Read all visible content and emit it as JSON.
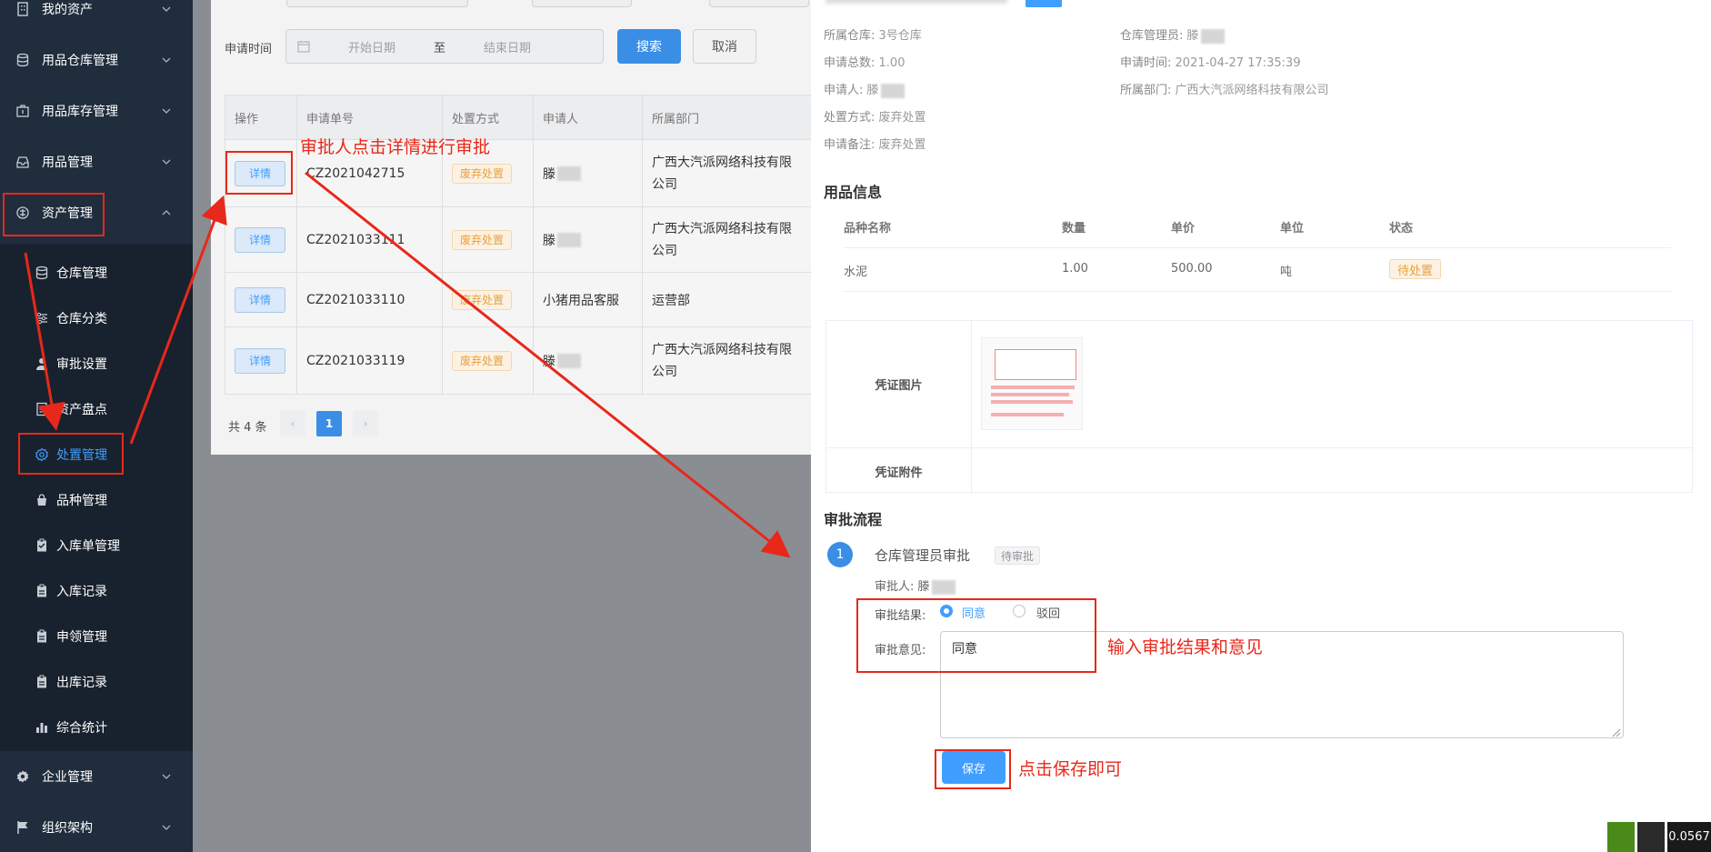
{
  "sidebar": {
    "top_items": [
      {
        "label": "我的资产",
        "icon": "building-icon"
      },
      {
        "label": "用品仓库管理",
        "icon": "database-icon"
      },
      {
        "label": "用品库存管理",
        "icon": "briefcase-icon"
      },
      {
        "label": "用品管理",
        "icon": "inbox-icon"
      },
      {
        "label": "资产管理",
        "icon": "asset-icon"
      }
    ],
    "sub_items": [
      {
        "label": "仓库管理",
        "icon": "database-icon"
      },
      {
        "label": "仓库分类",
        "icon": "sliders-icon"
      },
      {
        "label": "审批设置",
        "icon": "user-icon"
      },
      {
        "label": "资产盘点",
        "icon": "document-icon"
      },
      {
        "label": "处置管理",
        "icon": "gear-icon"
      },
      {
        "label": "品种管理",
        "icon": "bag-icon"
      },
      {
        "label": "入库单管理",
        "icon": "clipboard-icon"
      },
      {
        "label": "入库记录",
        "icon": "clipboard-icon"
      },
      {
        "label": "申领管理",
        "icon": "clipboard-icon"
      },
      {
        "label": "出库记录",
        "icon": "clipboard-icon"
      },
      {
        "label": "综合统计",
        "icon": "bar-chart-icon"
      }
    ],
    "bottom_items": [
      {
        "label": "企业管理",
        "icon": "gear-icon"
      },
      {
        "label": "组织架构",
        "icon": "flag-icon"
      }
    ]
  },
  "search": {
    "date_label": "申请时间",
    "start_placeholder": "开始日期",
    "separator": "至",
    "end_placeholder": "结束日期",
    "search_button": "搜索",
    "cancel_button": "取消"
  },
  "table": {
    "headers": [
      "操作",
      "申请单号",
      "处置方式",
      "申请人",
      "所属部门"
    ],
    "rows": [
      {
        "action": "详情",
        "no": "CZ2021042715",
        "method": "废弃处置",
        "applicant": "滕",
        "dept_line1": "广西大汽派网络科技有限",
        "dept_line2": "公司"
      },
      {
        "action": "详情",
        "no": "CZ2021033111",
        "method": "废弃处置",
        "applicant": "滕",
        "dept_line1": "广西大汽派网络科技有限",
        "dept_line2": "公司"
      },
      {
        "action": "详情",
        "no": "CZ2021033110",
        "method": "废弃处置",
        "applicant": "小猪用品客服",
        "dept_line1": "运营部",
        "dept_line2": ""
      },
      {
        "action": "详情",
        "no": "CZ2021033119",
        "method": "废弃处置",
        "applicant": "滕",
        "dept_line1": "广西大汽派网络科技有限",
        "dept_line2": "公司"
      }
    ]
  },
  "pagination": {
    "total": "共 4 条",
    "prev": "‹",
    "page": "1",
    "next": "›"
  },
  "drawer": {
    "warehouse_label": "所属仓库:",
    "warehouse": "3号仓库",
    "manager_label": "仓库管理员:",
    "manager": "滕",
    "total_label": "申请总数:",
    "total": "1.00",
    "time_label": "申请时间:",
    "time": "2021-04-27 17:35:39",
    "applicant_label": "申请人:",
    "applicant": "滕",
    "dept_label": "所属部门:",
    "dept": "广西大汽派网络科技有限公司",
    "method_label": "处置方式:",
    "method": "废弃处置",
    "remark_label": "申请备注:",
    "remark": "废弃处置",
    "goods_title": "用品信息",
    "goods_headers": [
      "品种名称",
      "数量",
      "单价",
      "单位",
      "状态"
    ],
    "goods_row": {
      "name": "水泥",
      "qty": "1.00",
      "price": "500.00",
      "unit": "吨",
      "status": "待处置"
    },
    "proof_image_label": "凭证图片",
    "proof_attach_label": "凭证附件",
    "flow_title": "审批流程",
    "step_number": "1",
    "step_name": "仓库管理员审批",
    "step_status": "待审批",
    "approver_label": "审批人:",
    "approver": "滕",
    "result_label": "审批结果:",
    "opt_agree": "同意",
    "opt_reject": "驳回",
    "opinion_label": "审批意见:",
    "opinion_value": "同意",
    "save_button": "保存"
  },
  "annotations": {
    "note1": "审批人点击详情进行审批",
    "note2": "输入审批结果和意见",
    "note3": "点击保存即可",
    "color": "#e8281a"
  },
  "corner_badge": "0.0567",
  "colors": {
    "sidebar_bg": "#1f2d3d",
    "primary": "#409eff",
    "warning": "#e6a23c"
  }
}
